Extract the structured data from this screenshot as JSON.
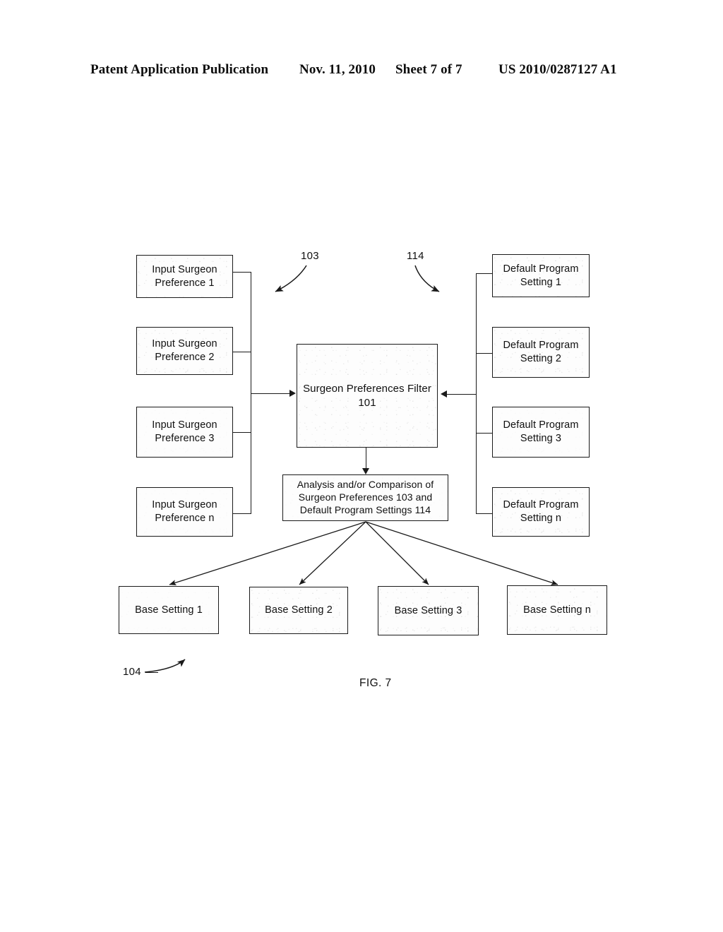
{
  "header": {
    "publication": "Patent Application Publication",
    "date": "Nov. 11, 2010",
    "sheet": "Sheet 7 of 7",
    "patent_number": "US 2010/0287127 A1"
  },
  "figure": {
    "label": "FIG. 7",
    "reference_numerals": {
      "inputs_group": "103",
      "defaults_group": "114",
      "outputs_group": "104"
    },
    "input_boxes": [
      {
        "line1": "Input Surgeon",
        "line2": "Preference 1"
      },
      {
        "line1": "Input Surgeon",
        "line2": "Preference 2"
      },
      {
        "line1": "Input Surgeon",
        "line2": "Preference 3"
      },
      {
        "line1": "Input Surgeon",
        "line2": "Preference n"
      }
    ],
    "default_boxes": [
      {
        "line1": "Default Program",
        "line2": "Setting 1"
      },
      {
        "line1": "Default Program",
        "line2": "Setting 2"
      },
      {
        "line1": "Default Program",
        "line2": "Setting 3"
      },
      {
        "line1": "Default Program",
        "line2": "Setting n"
      }
    ],
    "filter_box": {
      "line1": "Surgeon Preferences Filter",
      "line2": "101"
    },
    "analysis_box": {
      "line1": "Analysis and/or Comparison of",
      "line2": "Surgeon Preferences 103 and",
      "line3": "Default Program Settings 114"
    },
    "output_boxes": [
      {
        "label": "Base Setting 1"
      },
      {
        "label": "Base Setting 2"
      },
      {
        "label": "Base Setting 3"
      },
      {
        "label": "Base Setting n"
      }
    ]
  },
  "colors": {
    "ink": "#1a1a1a",
    "paper": "#ffffff"
  }
}
